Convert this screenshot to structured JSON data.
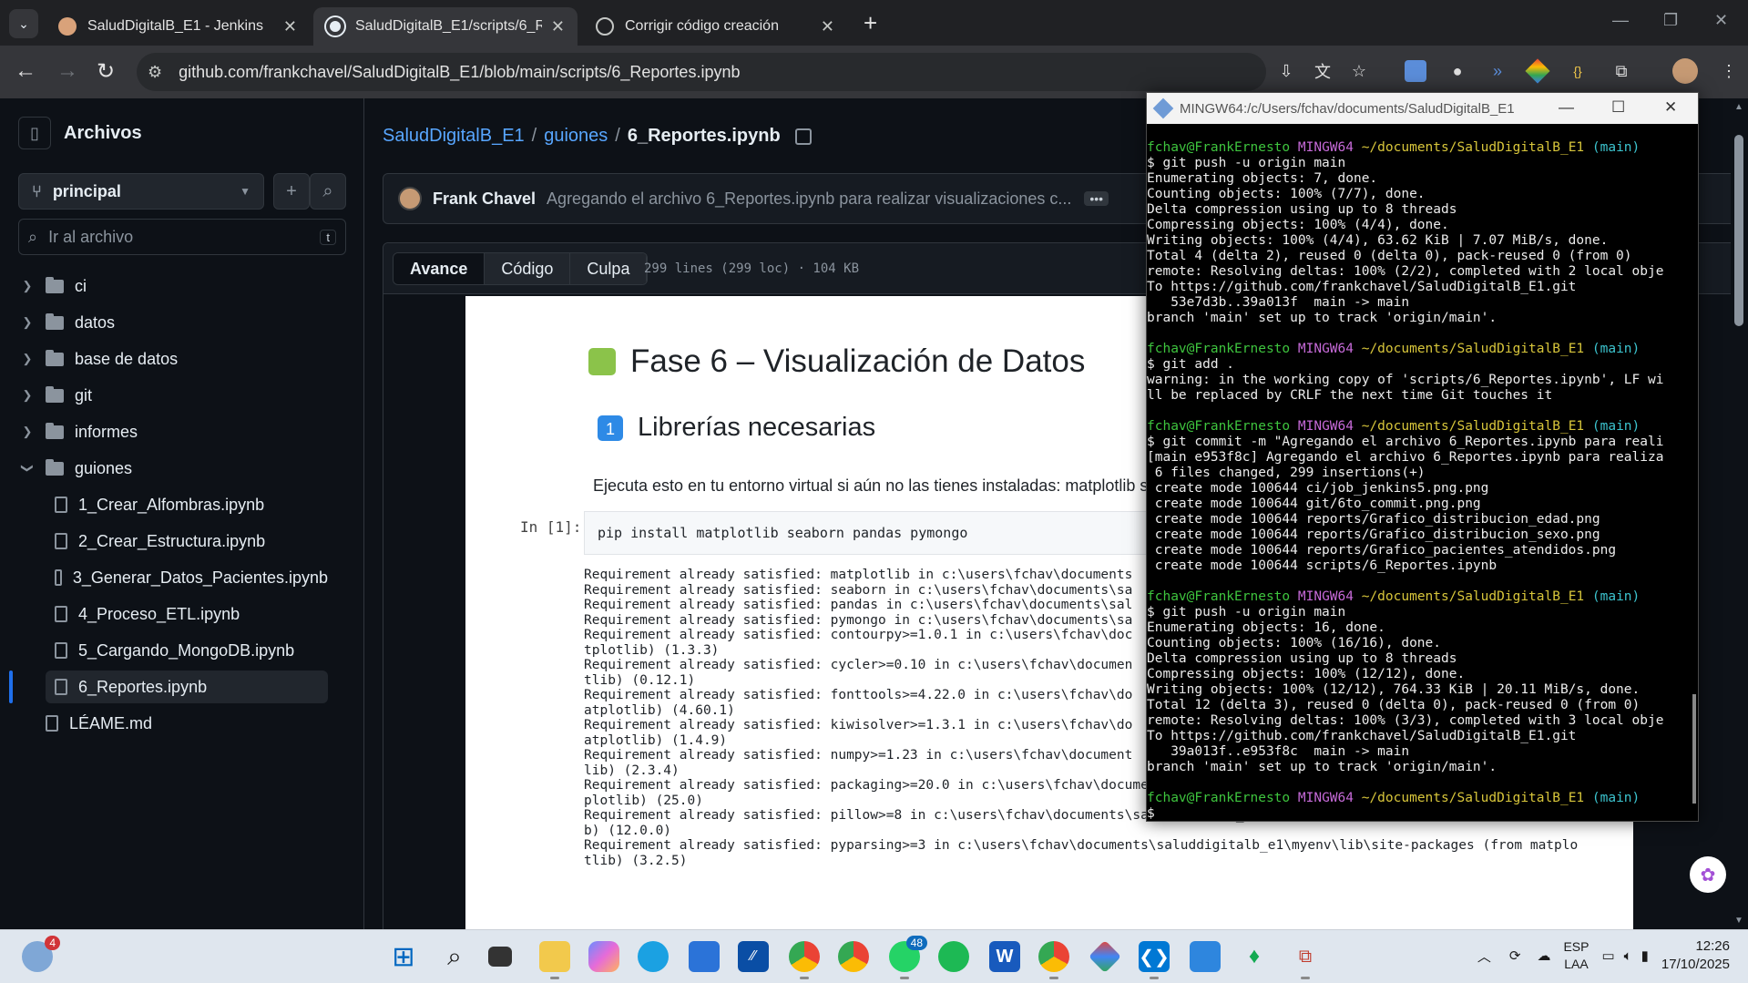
{
  "browser": {
    "tabs": [
      {
        "title": "SaludDigitalB_E1 - Jenkins",
        "active": false
      },
      {
        "title": "SaludDigitalB_E1/scripts/6_Repo",
        "active": true
      },
      {
        "title": "Corrigir código creación",
        "active": false
      }
    ],
    "url": "github.com/frankchavel/SaludDigitalB_E1/blob/main/scripts/6_Reportes.ipynb"
  },
  "sidebar": {
    "title": "Archivos",
    "branch": "principal",
    "goto_placeholder": "Ir al archivo",
    "goto_kbd": "t",
    "folders": [
      "ci",
      "datos",
      "base de datos",
      "git",
      "informes",
      "guiones"
    ],
    "files": [
      "1_Crear_Alfombras.ipynb",
      "2_Crear_Estructura.ipynb",
      "3_Generar_Datos_Pacientes.ipynb",
      "4_Proceso_ETL.ipynb",
      "5_Cargando_MongoDB.ipynb",
      "6_Reportes.ipynb"
    ],
    "root_file": "LÉAME.md"
  },
  "main": {
    "crumb_repo": "SaludDigitalB_E1",
    "crumb_dir": "guiones",
    "crumb_file": "6_Reportes.ipynb",
    "author": "Frank Chavel",
    "commit_msg": "Agregando el archivo 6_Reportes.ipynb para realizar visualizaciones c...",
    "more": "•••",
    "tabs": [
      "Avance",
      "Código",
      "Culpa"
    ],
    "file_info": "299 lines (299 loc) · 104 KB"
  },
  "notebook": {
    "h1": "Fase 6 – Visualización de Datos",
    "h2": "Librerías necesarias",
    "para": "Ejecuta esto en tu entorno virtual si aún no las tienes instaladas: matplotlib sea",
    "prompt": "In [1]:",
    "cell": "pip install matplotlib seaborn pandas pymongo",
    "output": [
      "Requirement already satisfied: matplotlib in c:\\users\\fchav\\documents",
      "Requirement already satisfied: seaborn in c:\\users\\fchav\\documents\\sa",
      "Requirement already satisfied: pandas in c:\\users\\fchav\\documents\\sal",
      "Requirement already satisfied: pymongo in c:\\users\\fchav\\documents\\sa",
      "Requirement already satisfied: contourpy>=1.0.1 in c:\\users\\fchav\\doc",
      "tplotlib) (1.3.3)",
      "Requirement already satisfied: cycler>=0.10 in c:\\users\\fchav\\documen",
      "tlib) (0.12.1)",
      "Requirement already satisfied: fonttools>=4.22.0 in c:\\users\\fchav\\do",
      "atplotlib) (4.60.1)",
      "Requirement already satisfied: kiwisolver>=1.3.1 in c:\\users\\fchav\\do",
      "atplotlib) (1.4.9)",
      "Requirement already satisfied: numpy>=1.23 in c:\\users\\fchav\\document",
      "lib) (2.3.4)",
      "Requirement already satisfied: packaging>=20.0 in c:\\users\\fchav\\documents\\saluddigitalb_e1\\myenv\\lib\\site-packages (from mat",
      "plotlib) (25.0)",
      "Requirement already satisfied: pillow>=8 in c:\\users\\fchav\\documents\\saluddigitalb_e1\\myenv\\lib\\site-packages (from matplotli",
      "b) (12.0.0)",
      "Requirement already satisfied: pyparsing>=3 in c:\\users\\fchav\\documents\\saluddigitalb_e1\\myenv\\lib\\site-packages (from matplo",
      "tlib) (3.2.5)"
    ]
  },
  "terminal": {
    "title": "MINGW64:/c/Users/fchav/documents/SaludDigitalB_E1",
    "prompt_user": "fchav@FrankErnesto",
    "prompt_env": "MINGW64",
    "prompt_path": "~/documents/SaludDigitalB_E1",
    "prompt_branch": "(main)",
    "blocks": [
      [
        "$ git push -u origin main",
        "Enumerating objects: 7, done.",
        "Counting objects: 100% (7/7), done.",
        "Delta compression using up to 8 threads",
        "Compressing objects: 100% (4/4), done.",
        "Writing objects: 100% (4/4), 63.62 KiB | 7.07 MiB/s, done.",
        "Total 4 (delta 2), reused 0 (delta 0), pack-reused 0 (from 0)",
        "remote: Resolving deltas: 100% (2/2), completed with 2 local obje",
        "To https://github.com/frankchavel/SaludDigitalB_E1.git",
        "   53e7d3b..39a013f  main -> main",
        "branch 'main' set up to track 'origin/main'."
      ],
      [
        "$ git add .",
        "warning: in the working copy of 'scripts/6_Reportes.ipynb', LF wi",
        "ll be replaced by CRLF the next time Git touches it"
      ],
      [
        "$ git commit -m \"Agregando el archivo 6_Reportes.ipynb para reali",
        "[main e953f8c] Agregando el archivo 6_Reportes.ipynb para realiza",
        " 6 files changed, 299 insertions(+)",
        " create mode 100644 ci/job_jenkins5.png.png",
        " create mode 100644 git/6to_commit.png.png",
        " create mode 100644 reports/Grafico_distribucion_edad.png",
        " create mode 100644 reports/Grafico_distribucion_sexo.png",
        " create mode 100644 reports/Grafico_pacientes_atendidos.png",
        " create mode 100644 scripts/6_Reportes.ipynb"
      ],
      [
        "$ git push -u origin main",
        "Enumerating objects: 16, done.",
        "Counting objects: 100% (16/16), done.",
        "Delta compression using up to 8 threads",
        "Compressing objects: 100% (12/12), done.",
        "Writing objects: 100% (12/12), 764.33 KiB | 20.11 MiB/s, done.",
        "Total 12 (delta 3), reused 0 (delta 0), pack-reused 0 (from 0)",
        "remote: Resolving deltas: 100% (3/3), completed with 3 local obje",
        "To https://github.com/frankchavel/SaludDigitalB_E1.git",
        "   39a013f..e953f8c  main -> main",
        "branch 'main' set up to track 'origin/main'."
      ],
      [
        "$ "
      ]
    ]
  },
  "taskbar": {
    "weather_badge": "4",
    "whatsapp_badge": "48",
    "lang1": "ESP",
    "lang2": "LAA",
    "time": "12:26",
    "date": "17/10/2025"
  },
  "colors": {
    "accent": "#58a6ff",
    "term_green": "#3ec43e",
    "term_magenta": "#c66ad8",
    "term_yellow": "#d8c63b",
    "term_cyan": "#3cc4cf"
  }
}
